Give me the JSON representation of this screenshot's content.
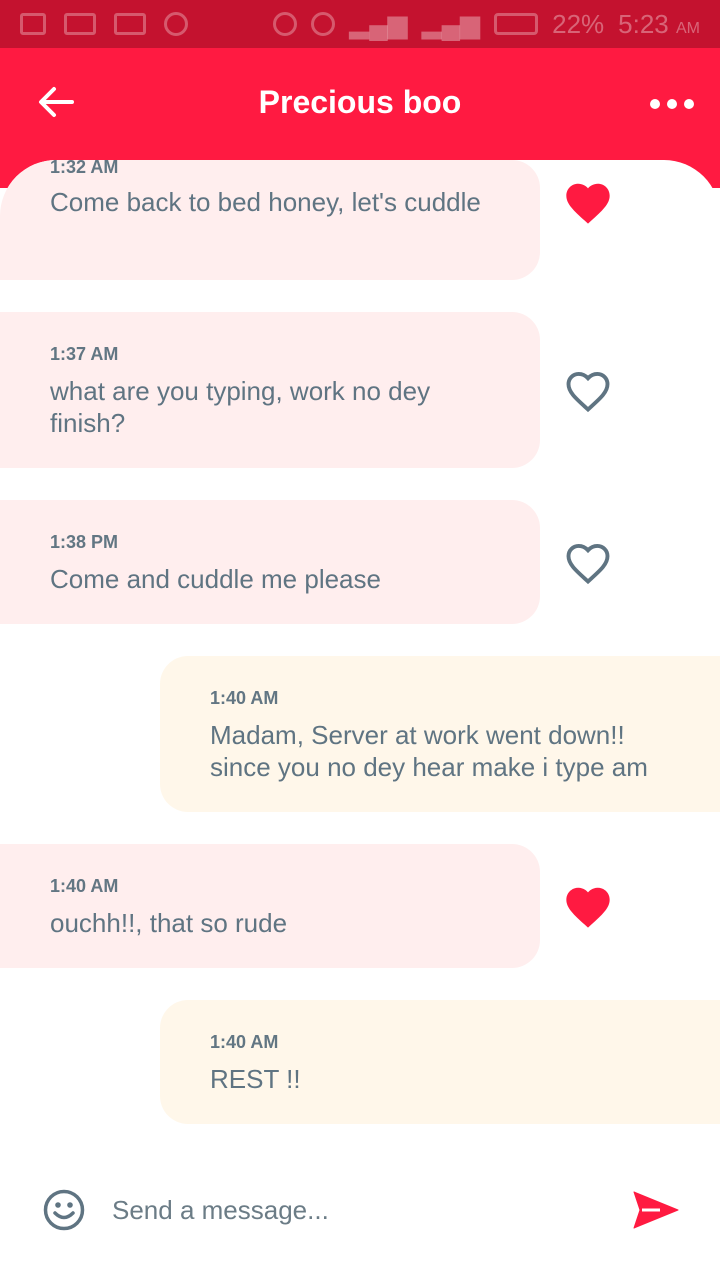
{
  "status_bar": {
    "battery": "22%",
    "time": "5:23",
    "ampm": "AM"
  },
  "header": {
    "title": "Precious boo"
  },
  "messages": [
    {
      "direction": "in",
      "time": "1:32 AM",
      "text": "Come back to bed honey, let's cuddle",
      "liked": true
    },
    {
      "direction": "in",
      "time": "1:37 AM",
      "text": "what are you typing, work no dey finish?",
      "liked": false
    },
    {
      "direction": "in",
      "time": "1:38 PM",
      "text": "Come and cuddle me please",
      "liked": false
    },
    {
      "direction": "out",
      "time": "1:40 AM",
      "text": "Madam, Server at work went down!! since you no dey hear make i type am"
    },
    {
      "direction": "in",
      "time": "1:40 AM",
      "text": "ouchh!!, that so rude",
      "liked": true
    },
    {
      "direction": "out",
      "time": "1:40 AM",
      "text": "REST !!"
    }
  ],
  "composer": {
    "placeholder": "Send a message...",
    "value": ""
  },
  "colors": {
    "accent": "#ff1a41",
    "status_bar": "#c4122f",
    "incoming_bubble": "#ffeeee",
    "outgoing_bubble": "#fff7ea",
    "text": "#5f7482",
    "heart_outline": "#5f7482"
  }
}
